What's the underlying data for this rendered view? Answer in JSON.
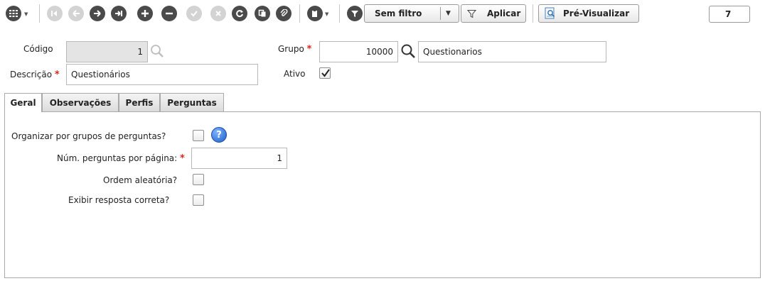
{
  "toolbar": {
    "filter_value": "Sem filtro",
    "apply_label": "Aplicar",
    "preview_label": "Pré-Visualizar",
    "page_number": "7"
  },
  "form": {
    "codigo_label": "Código",
    "codigo_value": "1",
    "descricao_label": "Descrição",
    "descricao_value": "Questionários",
    "grupo_label": "Grupo",
    "grupo_code": "10000",
    "grupo_name": "Questionarios",
    "ativo_label": "Ativo",
    "ativo_checked": true,
    "required_mark": "*"
  },
  "tabs": [
    {
      "label": "Geral",
      "active": true
    },
    {
      "label": "Observações",
      "active": false
    },
    {
      "label": "Perfis",
      "active": false
    },
    {
      "label": "Perguntas",
      "active": false
    }
  ],
  "geral": {
    "organizar_label": "Organizar por grupos de perguntas?",
    "num_perguntas_label": "Núm. perguntas por página:",
    "num_perguntas_value": "1",
    "ordem_label": "Ordem aleatória?",
    "exibir_label": "Exibir resposta correta?",
    "help_glyph": "?"
  }
}
